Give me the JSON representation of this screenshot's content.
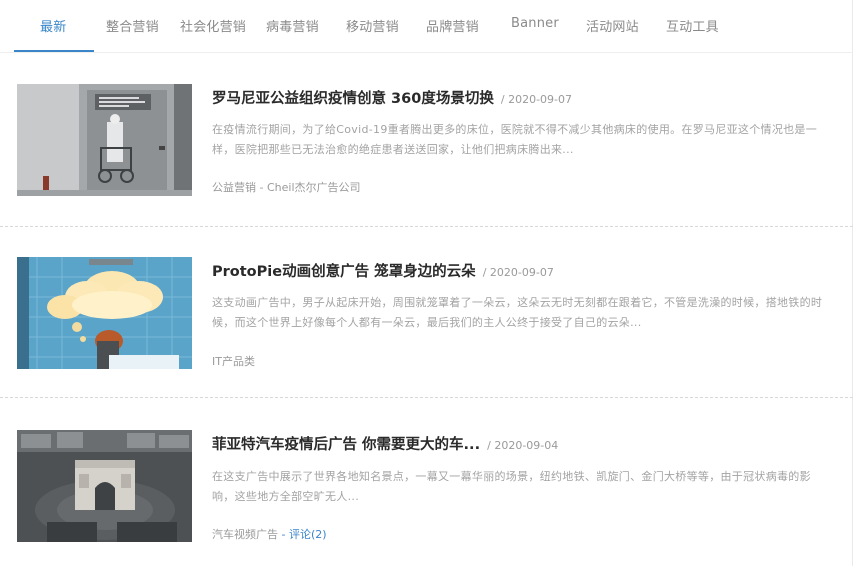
{
  "tabs": [
    {
      "label": "最新",
      "active": true
    },
    {
      "label": "整合营销"
    },
    {
      "label": "社会化营销"
    },
    {
      "label": "病毒营销"
    },
    {
      "label": "移动营销"
    },
    {
      "label": "品牌营销"
    },
    {
      "label": "Banner"
    },
    {
      "label": "活动网站"
    },
    {
      "label": "互动工具"
    }
  ],
  "articles": [
    {
      "title": "罗马尼亚公益组织疫情创意 360度场景切换",
      "date": "/ 2020-09-07",
      "summary": "在疫情流行期间，为了给Covid-19重者腾出更多的床位，医院就不得不减少其他病床的使用。在罗马尼亚这个情况也是一样，医院把那些已无法治愈的绝症患者送送回家，让他们把病床腾出来...",
      "tag": "公益营销",
      "agency": "- Cheil杰尔广告公司"
    },
    {
      "title": "ProtoPie动画创意广告 笼罩身边的云朵",
      "date": "/ 2020-09-07",
      "summary": "这支动画广告中，男子从起床开始，周围就笼罩着了一朵云，这朵云无时无刻都在跟着它，不管是洗澡的时候，搭地铁的时候，而这个世界上好像每个人都有一朵云，最后我们的主人公终于接受了自己的云朵...",
      "tag": "IT产品类"
    },
    {
      "title": "菲亚特汽车疫情后广告 你需要更大的车...",
      "date": "/ 2020-09-04",
      "summary": "在这支广告中展示了世界各地知名景点，一幕又一幕华丽的场景，纽约地铁、凯旋门、金门大桥等等，由于冠状病毒的影响，这些地方全部空旷无人...",
      "tag": "汽车视频广告",
      "comments": "- 评论(2)"
    }
  ],
  "colors": {
    "accent": "#3a86c9",
    "title": "#2a2a2a",
    "muted": "#a3a3a3"
  }
}
